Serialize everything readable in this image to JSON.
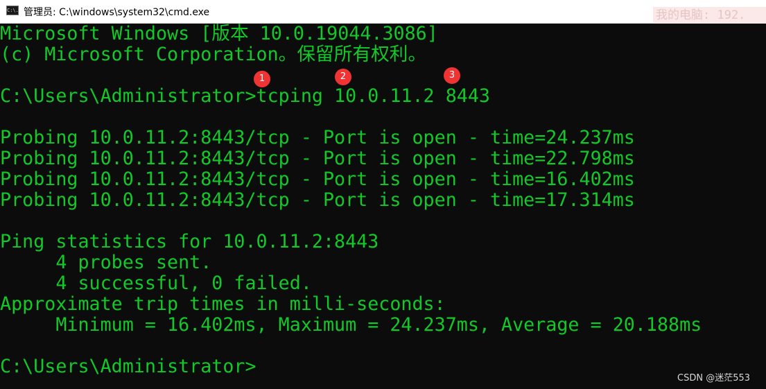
{
  "window": {
    "icon": "cmd-icon",
    "icon_text": "C:\\.",
    "title": "管理员: C:\\windows\\system32\\cmd.exe",
    "watermark": "我的电脑: 192."
  },
  "console": {
    "lines": [
      "Microsoft Windows [版本 10.0.19044.3086]",
      "(c) Microsoft Corporation。保留所有权利。",
      "",
      "C:\\Users\\Administrator>tcping 10.0.11.2 8443",
      "",
      "Probing 10.0.11.2:8443/tcp - Port is open - time=24.237ms",
      "Probing 10.0.11.2:8443/tcp - Port is open - time=22.798ms",
      "Probing 10.0.11.2:8443/tcp - Port is open - time=16.402ms",
      "Probing 10.0.11.2:8443/tcp - Port is open - time=17.314ms",
      "",
      "Ping statistics for 10.0.11.2:8443",
      "     4 probes sent.",
      "     4 successful, 0 failed.",
      "Approximate trip times in milli-seconds:",
      "     Minimum = 16.402ms, Maximum = 24.237ms, Average = 20.188ms",
      "",
      "C:\\Users\\Administrator>"
    ],
    "text_color": "#13c829",
    "background": "#0c0c0c"
  },
  "annotations": [
    "1",
    "2",
    "3"
  ],
  "annotation_color": "#f03434",
  "footer": {
    "csdn": "CSDN @迷茫553"
  }
}
